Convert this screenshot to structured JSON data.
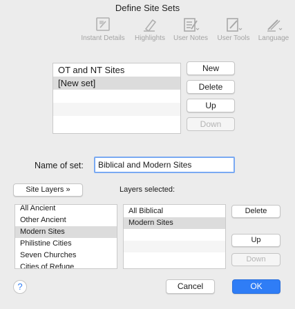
{
  "window": {
    "title": "Define Site Sets"
  },
  "toolbar": {
    "items": [
      {
        "label": "Instant Details",
        "icon": "instant-details-icon"
      },
      {
        "label": "Highlights",
        "icon": "highlighter-icon"
      },
      {
        "label": "User Notes",
        "icon": "notes-icon"
      },
      {
        "label": "User Tools",
        "icon": "user-tools-icon"
      },
      {
        "label": "Language",
        "icon": "language-icon"
      }
    ]
  },
  "sets": {
    "items": [
      "OT and NT Sites",
      "[New set]"
    ],
    "selected_index": 1,
    "buttons": {
      "new": "New",
      "delete": "Delete",
      "up": "Up",
      "down": "Down"
    }
  },
  "name_field": {
    "label": "Name of set:",
    "value": "Biblical and Modern Sites"
  },
  "site_layers": {
    "button_label": "Site Layers »",
    "items": [
      "All Ancient",
      "Other Ancient",
      "Modern Sites",
      "Philistine Cities",
      "Seven Churches",
      "Cities of Refuge"
    ],
    "selected_index": 2
  },
  "layers_selected": {
    "label": "Layers selected:",
    "items": [
      "All Biblical",
      "Modern Sites"
    ],
    "selected_index": 1,
    "buttons": {
      "delete": "Delete",
      "up": "Up",
      "down": "Down"
    }
  },
  "footer": {
    "help": "?",
    "cancel": "Cancel",
    "ok": "OK"
  },
  "colors": {
    "accent": "#2f7df6",
    "selection": "#dcdcdc",
    "disabled_text": "#b4b4b4"
  }
}
